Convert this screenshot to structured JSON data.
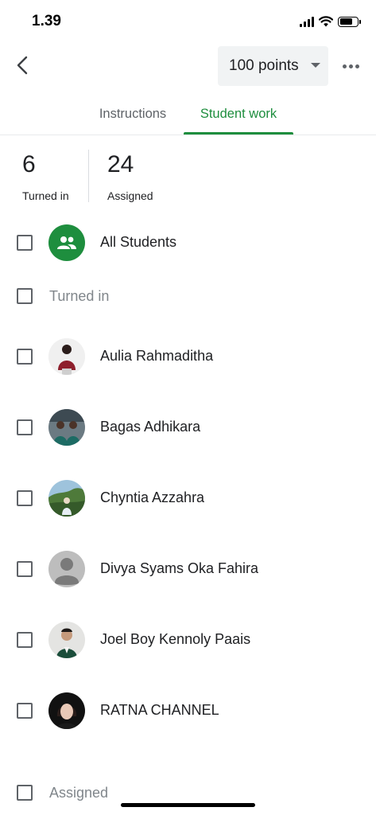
{
  "status_bar": {
    "time": "1.39"
  },
  "header": {
    "points_label": "100 points"
  },
  "tabs": [
    {
      "label": "Instructions",
      "active": false
    },
    {
      "label": "Student work",
      "active": true
    }
  ],
  "summary": {
    "turned_in": {
      "count": "6",
      "label": "Turned in"
    },
    "assigned": {
      "count": "24",
      "label": "Assigned"
    }
  },
  "all_students": {
    "label": "All Students"
  },
  "sections": {
    "turned_in_label": "Turned in",
    "assigned_label": "Assigned"
  },
  "students": [
    {
      "name": "Aulia Rahmaditha"
    },
    {
      "name": "Bagas Adhikara"
    },
    {
      "name": "Chyntia Azzahra"
    },
    {
      "name": "Divya Syams Oka Fahira"
    },
    {
      "name": "Joel Boy Kennoly Paais"
    },
    {
      "name": "RATNA CHANNEL"
    }
  ],
  "colors": {
    "accent": "#1e8e3e",
    "text_secondary": "#5f6368",
    "placeholder_avatar": "#bdbdbd"
  }
}
